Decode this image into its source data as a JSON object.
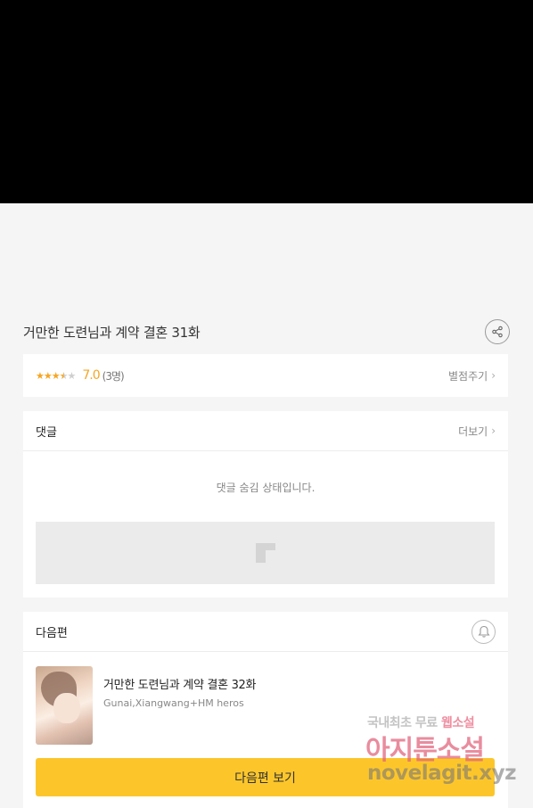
{
  "episode": {
    "title": "거만한 도련님과 계약 결혼 31화"
  },
  "rating": {
    "stars_filled": 3.5,
    "stars_total": 5,
    "score": "7.0",
    "voters": "(3명)",
    "rate_link": "별점주기"
  },
  "comments": {
    "title": "댓글",
    "more_link": "더보기",
    "hidden_message": "댓글 숨김 상태입니다."
  },
  "next_episode": {
    "section_title": "다음편",
    "title": "거만한 도련님과 계약 결혼 32화",
    "author": "Gunai,Xiangwang+HM heros",
    "button_label": "다음편 보기"
  },
  "watermark": {
    "line1_gray": "국내최초 무료",
    "line1_pink": "웹소설",
    "line2": "아지툰소설",
    "line3": "novelagit.xyz"
  },
  "colors": {
    "accent": "#f5a623",
    "button": "#fcc62b",
    "background": "#f5f5f5"
  }
}
